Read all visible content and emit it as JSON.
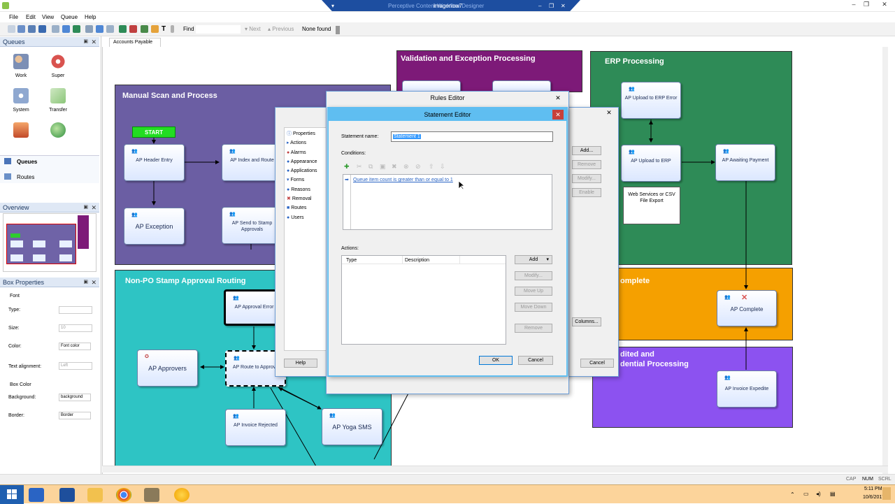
{
  "app": {
    "title": "imagenow7",
    "title_faded": "Perceptive Content Workflow Designer",
    "tab": "Accounts Payable"
  },
  "menu": [
    "File",
    "Edit",
    "View",
    "Queue",
    "Help"
  ],
  "toolbar": {
    "find_label": "Find",
    "find_value": "",
    "next": "Next",
    "previous": "Previous",
    "result": "None found"
  },
  "queues_panel": {
    "title": "Queues",
    "items": [
      {
        "label": "Work",
        "icon": "users-icon"
      },
      {
        "label": "Super",
        "icon": "super-queue-icon"
      },
      {
        "label": "System",
        "icon": "gears-icon"
      },
      {
        "label": "Transfer",
        "icon": "transfer-icon"
      }
    ],
    "tabs": [
      "Queues",
      "Routes"
    ]
  },
  "overview_panel": {
    "title": "Overview"
  },
  "box_props": {
    "title": "Box Properties",
    "font_heading": "Font",
    "type_label": "Type:",
    "type_value": "",
    "size_label": "Size:",
    "size_value": "10",
    "color_label": "Color:",
    "color_value": "Font color",
    "align_label": "Text alignment:",
    "align_value": "Left",
    "box_color_heading": "Box Color",
    "background_label": "Background:",
    "background_value": "background",
    "border_label": "Border:",
    "border_value": "Border"
  },
  "diagram": {
    "regions": {
      "manual": "Manual Scan and Process",
      "validation": "Validation and Exception Processing",
      "erp": "ERP Processing",
      "nonpo": "Non-PO Stamp Approval Routing",
      "complete": "omplete",
      "audited": "dited and\ndential Processing"
    },
    "start_label": "START",
    "nodes": {
      "ap_header": "AP Header Entry",
      "ap_index": "AP Index and Route",
      "ap_exception": "AP Exception",
      "ap_send_stamp": "AP Send to Stamp Approvals",
      "ap_upload_error": "AP Upload to ERP Error",
      "ap_upload": "AP Upload to ERP",
      "ap_awaiting": "AP Awaiting Payment",
      "web_services": "Web Services or CSV File Export",
      "ap_complete": "AP Complete",
      "ap_expedite": "AP Invoice Expedite",
      "ap_approval_error": "AP Approval Error",
      "ap_approvers": "AP Approvers",
      "ap_route_approve": "AP Route to Approve",
      "ap_invoice_rejected": "AP Invoice Rejected",
      "ap_yoga": "AP Yoga SMS"
    }
  },
  "routes_dialog": {
    "tree": [
      "Properties",
      "Actions",
      "Alarms",
      "Appearance",
      "Applications",
      "Forms",
      "Reasons",
      "Removal",
      "Routes",
      "Users"
    ],
    "buttons": {
      "add": "Add...",
      "remove": "Remove",
      "modify": "Modify...",
      "enable": "Enable",
      "columns": "Columns...",
      "help": "Help",
      "cancel": "Cancel"
    }
  },
  "rules_editor": {
    "title": "Rules Editor"
  },
  "statement_editor": {
    "title": "Statement Editor",
    "name_label": "Statement name:",
    "name_value": "Statement 1",
    "conditions_label": "Conditions:",
    "condition": "Queue item count is greater than or equal to 1",
    "actions_label": "Actions:",
    "col_type": "Type",
    "col_description": "Description",
    "add": "Add",
    "modify": "Modify...",
    "move_up": "Move Up",
    "move_down": "Move Down",
    "remove": "Remove",
    "ok": "OK",
    "cancel": "Cancel"
  },
  "statusbar": {
    "caps": "CAP",
    "num": "NUM",
    "scrl": "SCRL"
  },
  "taskbar": {
    "time": "5:11 PM",
    "date": "10/6/2017"
  }
}
